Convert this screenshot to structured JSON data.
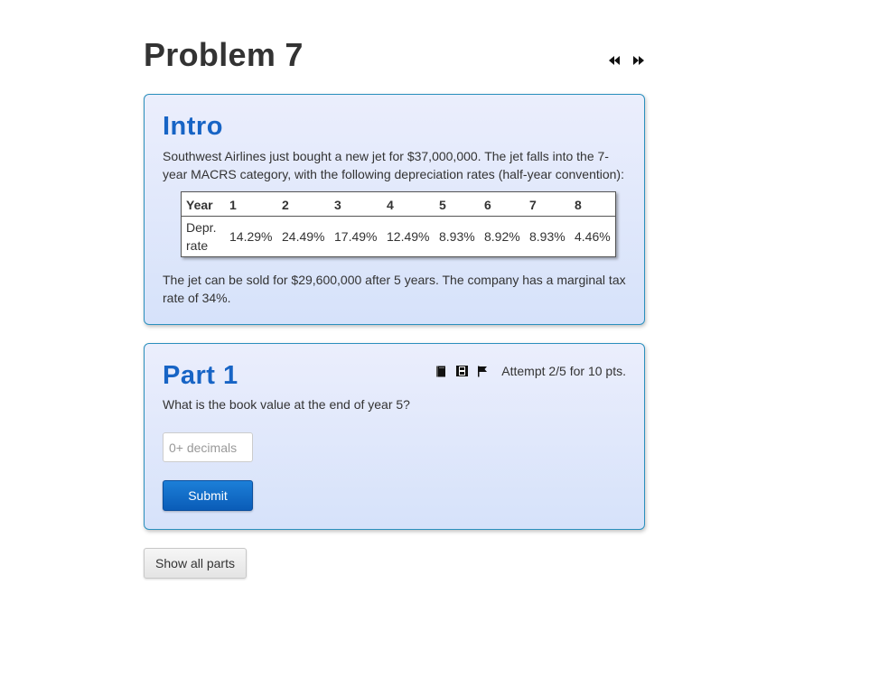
{
  "page": {
    "title": "Problem 7",
    "nav": {
      "prev_icon": "rewind-icon",
      "next_icon": "fast-forward-icon"
    }
  },
  "intro": {
    "title": "Intro",
    "paragraph1": "Southwest Airlines just bought a new jet for $37,000,000. The jet falls into the 7-year MACRS category, with the following depreciation rates (half-year convention):",
    "table": {
      "header_label": "Year",
      "years": [
        "1",
        "2",
        "3",
        "4",
        "5",
        "6",
        "7",
        "8"
      ],
      "row_label": "Depr. rate",
      "rates": [
        "14.29%",
        "24.49%",
        "17.49%",
        "12.49%",
        "8.93%",
        "8.92%",
        "8.93%",
        "4.46%"
      ]
    },
    "paragraph2": "The jet can be sold for $29,600,000 after 5 years. The company has a marginal tax rate of 34%."
  },
  "part1": {
    "title": "Part 1",
    "tools": {
      "book_icon": "book-icon",
      "film_icon": "film-icon",
      "flag_icon": "flag-icon"
    },
    "attempt": "Attempt 2/5 for 10 pts.",
    "question": "What is the book value at the end of year 5?",
    "input_placeholder": "0+ decimals",
    "input_value": "",
    "submit_label": "Submit"
  },
  "footer": {
    "show_all_label": "Show all parts"
  },
  "colors": {
    "title_blue": "#1764c5",
    "card_border": "#2a8fbd",
    "submit_blue": "#0a5cb8"
  }
}
